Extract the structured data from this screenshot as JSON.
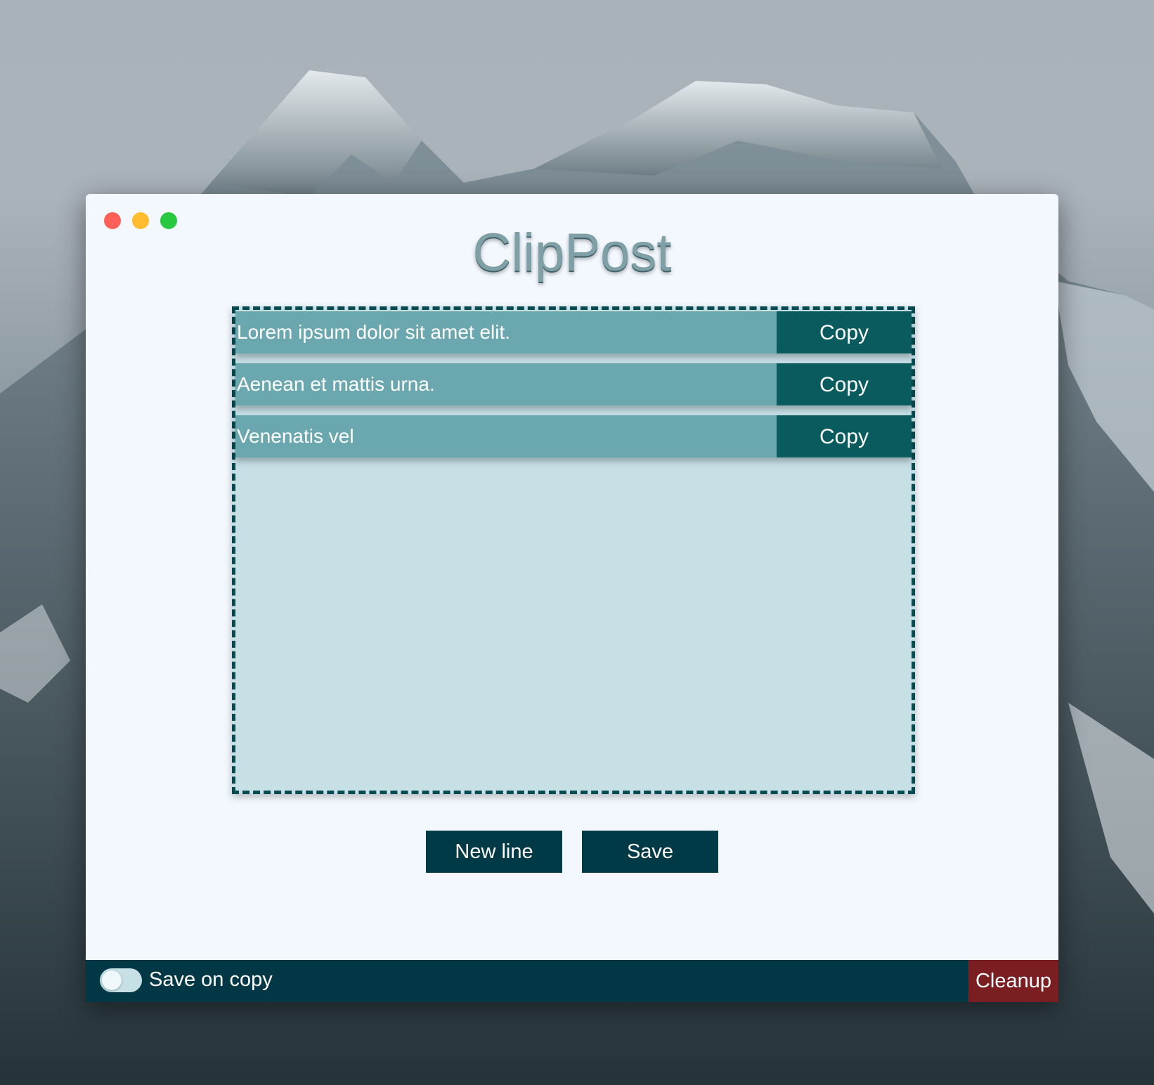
{
  "app": {
    "title": "ClipPost"
  },
  "window_controls": {
    "close_color": "#fe5f57",
    "minimize_color": "#febc2e",
    "zoom_color": "#28c840"
  },
  "clips": [
    {
      "text": "Lorem ipsum dolor sit amet elit.",
      "copy_label": "Copy"
    },
    {
      "text": "Aenean et mattis urna.",
      "copy_label": "Copy"
    },
    {
      "text": "Venenatis vel",
      "copy_label": "Copy"
    }
  ],
  "actions": {
    "new_line_label": "New line",
    "save_label": "Save"
  },
  "footer": {
    "save_on_copy_label": "Save on copy",
    "save_on_copy_enabled": false,
    "cleanup_label": "Cleanup"
  },
  "colors": {
    "accent": "#013a47",
    "row_fill": "#6ba7ae",
    "copy_button": "#0a5b5e",
    "clip_area": "#c6e0e6",
    "danger": "#7a1e22"
  }
}
